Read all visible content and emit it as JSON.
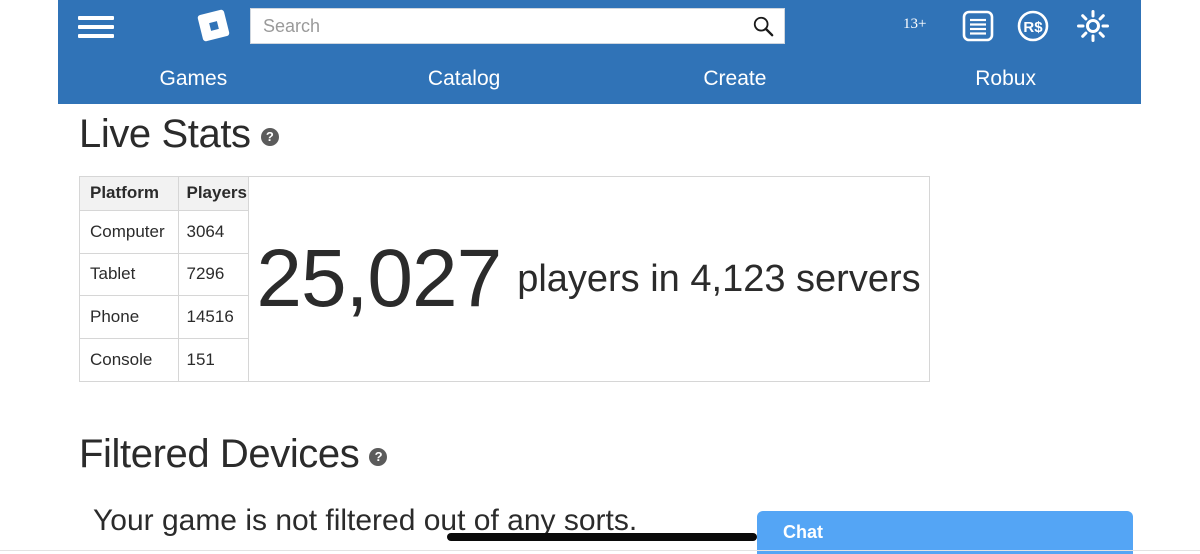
{
  "header": {
    "menu_icon": "hamburger-icon",
    "logo_icon": "roblox-logo-icon",
    "search": {
      "placeholder": "Search",
      "value": "",
      "icon": "search-icon"
    },
    "age_badge": "13+",
    "icons": [
      {
        "name": "list-icon",
        "label": "Inventory"
      },
      {
        "name": "robux-icon",
        "label": "R$"
      },
      {
        "name": "gear-icon",
        "label": "Settings"
      }
    ],
    "nav": [
      {
        "label": "Games"
      },
      {
        "label": "Catalog"
      },
      {
        "label": "Create"
      },
      {
        "label": "Robux"
      }
    ],
    "colors": {
      "background": "#3073b7",
      "text": "#ffffff"
    }
  },
  "main": {
    "live_stats": {
      "title": "Live Stats",
      "help_glyph": "?",
      "table": {
        "columns": [
          "Platform",
          "Players"
        ],
        "rows": [
          {
            "platform": "Computer",
            "players": "3064"
          },
          {
            "platform": "Tablet",
            "players": "7296"
          },
          {
            "platform": "Phone",
            "players": "14516"
          },
          {
            "platform": "Console",
            "players": "151"
          }
        ]
      },
      "summary": {
        "count": "25,027",
        "text": "players in 4,123 servers",
        "players_total": 25027,
        "servers_total": 4123
      }
    },
    "filtered_devices": {
      "title": "Filtered Devices",
      "help_glyph": "?",
      "body": "Your game is not filtered out of any sorts."
    }
  },
  "chat": {
    "label": "Chat",
    "color": "#54a5f5"
  },
  "annotation": {
    "type": "hand-drawn-underline",
    "color": "#0a0a0a"
  }
}
